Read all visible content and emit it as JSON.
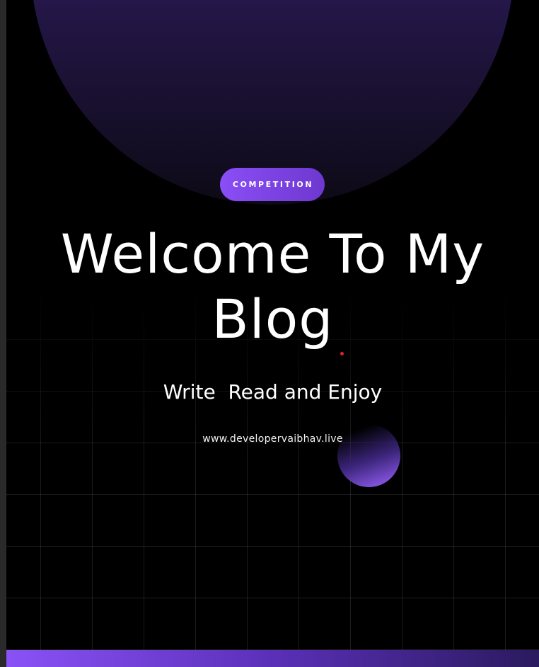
{
  "badge": {
    "label": "COMPETITION"
  },
  "hero": {
    "title_line_1": "Welcome To My",
    "title_line_2": "Blog",
    "subtitle": "Write  Read and Enjoy",
    "website": "www.developervaibhav.live"
  },
  "colors": {
    "background": "#000000",
    "accent": "#8a4ef6",
    "accent_dark": "#2a1a5e",
    "dot": "#e0222d"
  }
}
